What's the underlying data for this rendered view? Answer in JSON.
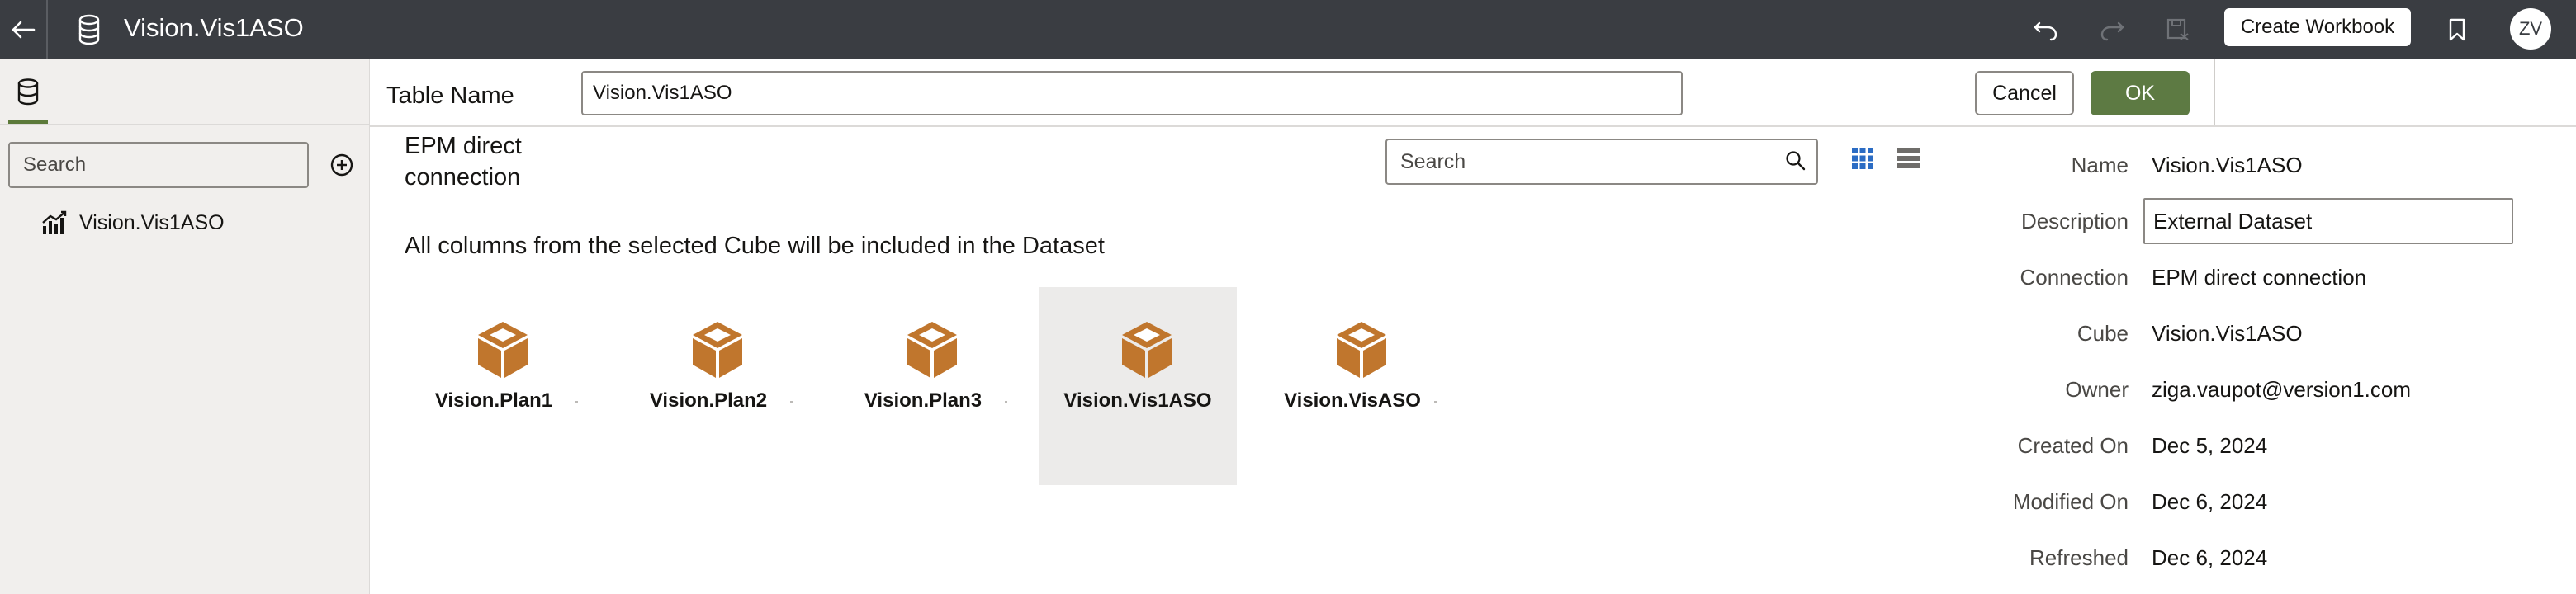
{
  "header": {
    "title": "Vision.Vis1ASO",
    "create_workbook_label": "Create Workbook",
    "user_initials": "ZV",
    "icons": [
      "back-arrow-icon",
      "database-icon",
      "undo-icon",
      "redo-icon",
      "save-icon",
      "bookmark-icon"
    ]
  },
  "left_panel": {
    "search_placeholder": "Search",
    "tree_items": [
      {
        "label": "Vision.Vis1ASO",
        "icon": "dataset-chart-icon"
      }
    ]
  },
  "table_name": {
    "label": "Table Name",
    "value": "Vision.Vis1ASO",
    "cancel_label": "Cancel",
    "ok_label": "OK",
    "ok_color": "#5d7a43"
  },
  "content": {
    "connection_title": "EPM direct connection",
    "search_placeholder": "Search",
    "info_text": "All columns from the selected Cube will be included in the Dataset",
    "cubes": [
      {
        "label": "Vision.Plan1",
        "selected": false
      },
      {
        "label": "Vision.Plan2",
        "selected": false
      },
      {
        "label": "Vision.Plan3",
        "selected": false
      },
      {
        "label": "Vision.Vis1ASO",
        "selected": true
      },
      {
        "label": "Vision.VisASO",
        "selected": false
      }
    ],
    "cube_color": "#c0762d"
  },
  "properties": {
    "name_label": "Name",
    "name_value": "Vision.Vis1ASO",
    "description_label": "Description",
    "description_value": "External Dataset",
    "connection_label": "Connection",
    "connection_value": "EPM direct connection",
    "cube_label": "Cube",
    "cube_value": "Vision.Vis1ASO",
    "owner_label": "Owner",
    "owner_value": "ziga.vaupot@version1.com",
    "created_label": "Created On",
    "created_value": "Dec 5, 2024",
    "modified_label": "Modified On",
    "modified_value": "Dec 6, 2024",
    "refreshed_label": "Refreshed",
    "refreshed_value": "Dec 6, 2024"
  }
}
